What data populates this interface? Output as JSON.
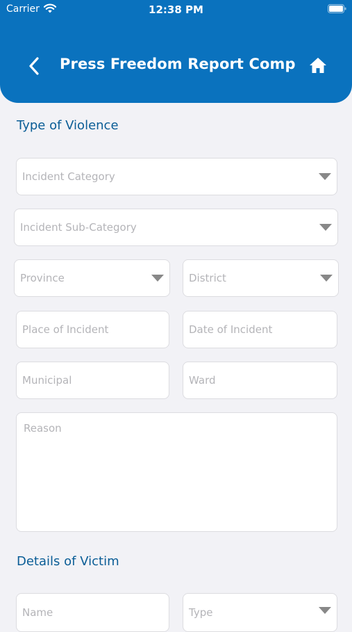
{
  "status_bar": {
    "carrier": "Carrier",
    "time": "12:38 PM"
  },
  "header": {
    "title": "Press Freedom Report Comp...",
    "back_icon": "chevron-left-icon",
    "home_icon": "home-icon",
    "color": "#0a72be"
  },
  "sections": {
    "violence_title": "Type of Violence",
    "victim_title": "Details of Victim"
  },
  "form": {
    "incident_category": "Incident Category",
    "incident_sub_category": "Incident Sub-Category",
    "province": "Province",
    "district": "District",
    "place_of_incident": "Place of Incident",
    "date_of_incident": "Date of Incident",
    "municipal": "Municipal",
    "ward": "Ward",
    "reason": "Reason",
    "name": "Name",
    "type": "Type"
  }
}
